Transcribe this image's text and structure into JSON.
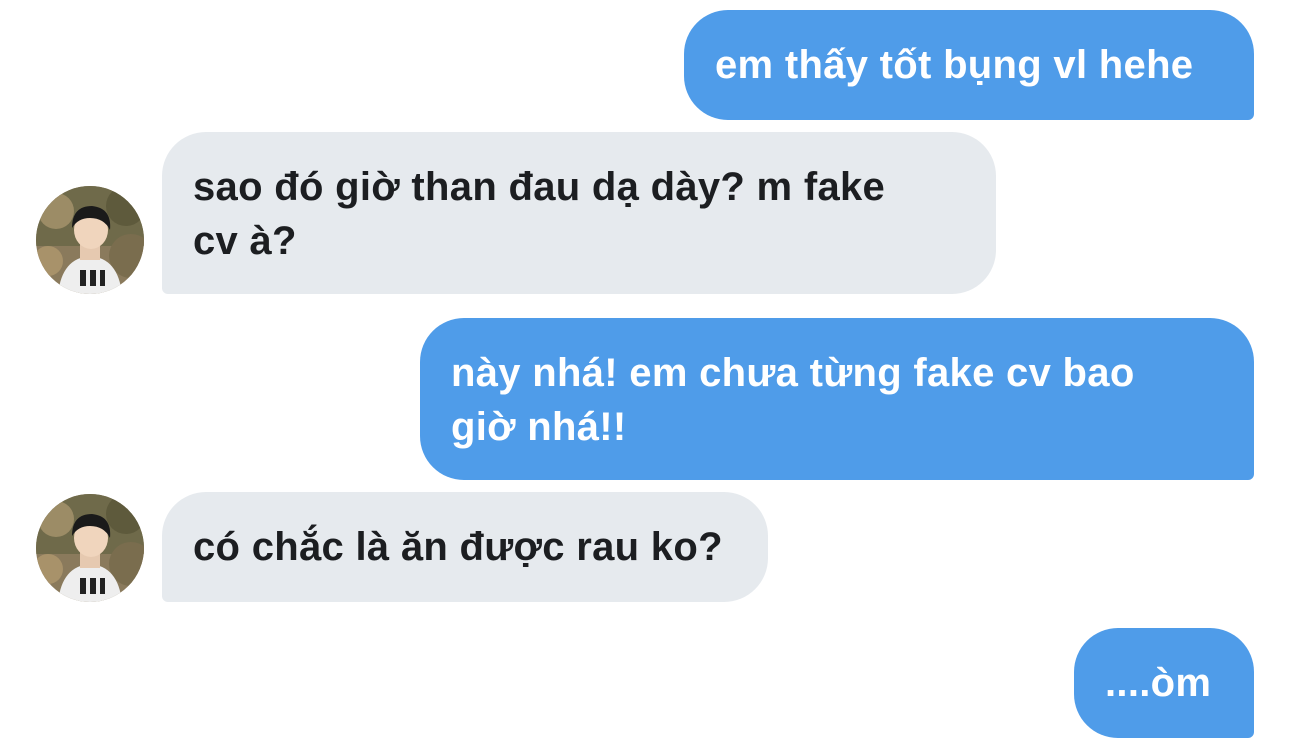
{
  "chat": {
    "messages": [
      {
        "sender": "me",
        "text": "em thấy tốt bụng vl hehe"
      },
      {
        "sender": "other",
        "text": "sao đó giờ than đau dạ dày? m fake cv à?"
      },
      {
        "sender": "me",
        "text": "này nhá! em chưa từng fake cv bao giờ nhá!!"
      },
      {
        "sender": "other",
        "text": "có chắc là ăn được rau ko?"
      },
      {
        "sender": "me",
        "text": "....òm"
      }
    ]
  },
  "colors": {
    "sent_bubble": "#4f9ce9",
    "received_bubble": "#e6eaee",
    "sent_text": "#ffffff",
    "received_text": "#1c1e21"
  }
}
